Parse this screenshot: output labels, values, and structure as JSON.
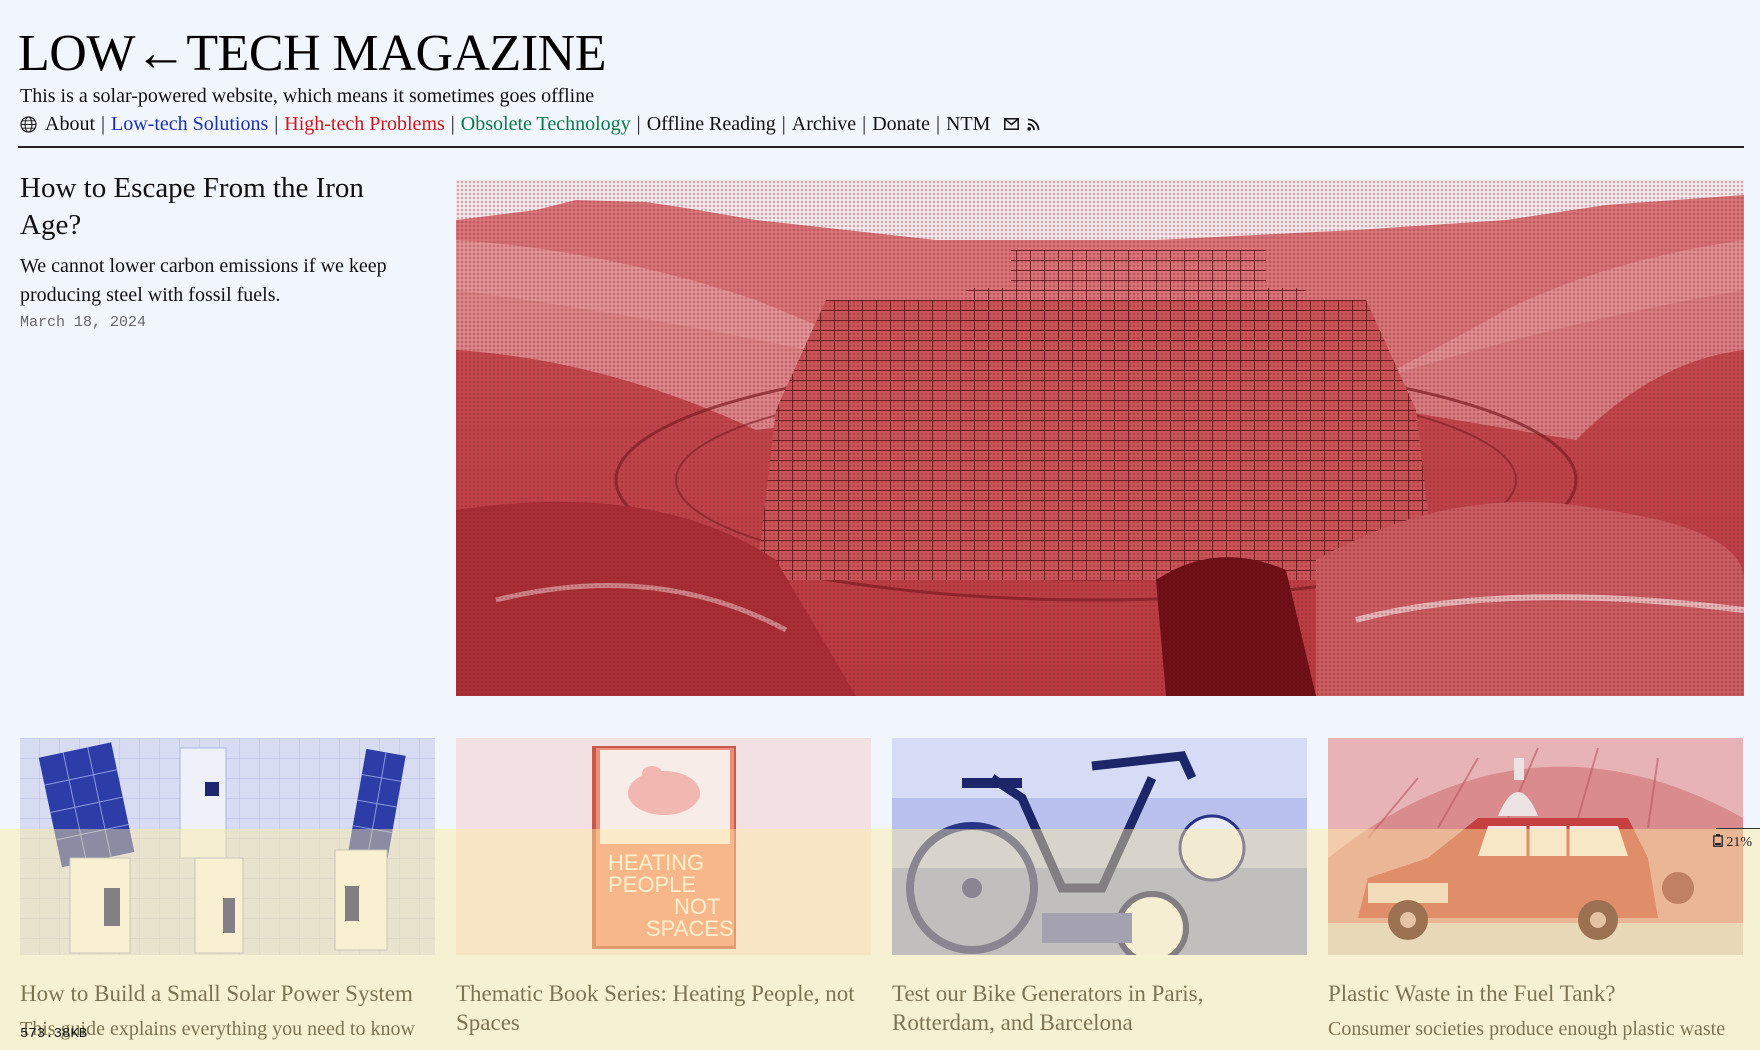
{
  "site": {
    "title": "LOW←TECH MAGAZINE",
    "tagline": "This is a solar-powered website, which means it sometimes goes offline"
  },
  "nav": {
    "items": [
      {
        "label": "About",
        "color": "#111111"
      },
      {
        "label": "Low-tech Solutions",
        "color": "#1a2fb5"
      },
      {
        "label": "High-tech Problems",
        "color": "#d1161b"
      },
      {
        "label": "Obsolete Technology",
        "color": "#0a7a4a"
      },
      {
        "label": "Offline Reading",
        "color": "#111111"
      },
      {
        "label": "Archive",
        "color": "#111111"
      },
      {
        "label": "Donate",
        "color": "#111111"
      },
      {
        "label": "NTM",
        "color": "#111111"
      }
    ],
    "separator": "|",
    "icons": [
      "globe-icon",
      "mail-icon",
      "rss-icon"
    ]
  },
  "featured": {
    "title": "How to Escape From the Iron Age?",
    "summary": "We cannot lower carbon emissions if we keep producing steel with fossil fuels.",
    "date": "March 18, 2024",
    "image_tint": "#c8454a"
  },
  "cards": [
    {
      "title": "How to Build a Small Solar Power System",
      "summary": "This guide explains everything you need to know",
      "image_tint": "#3f56c6"
    },
    {
      "title": "Thematic Book Series: Heating People, not Spaces",
      "summary": "",
      "image_tint": "#e8715f",
      "book_text": "HEATING PEOPLE NOT SPACES"
    },
    {
      "title": "Test our Bike Generators in Paris, Rotterdam, and Barcelona",
      "summary": "",
      "image_tint": "#3f56c6"
    },
    {
      "title": "Plastic Waste in the Fuel Tank?",
      "summary": "Consumer societies produce enough plastic waste",
      "image_tint": "#c8454a"
    }
  ],
  "status": {
    "battery_percent": "21%",
    "battery_level": 0.21,
    "page_size": "573.38KB",
    "battery_color": "#ffec9e"
  }
}
